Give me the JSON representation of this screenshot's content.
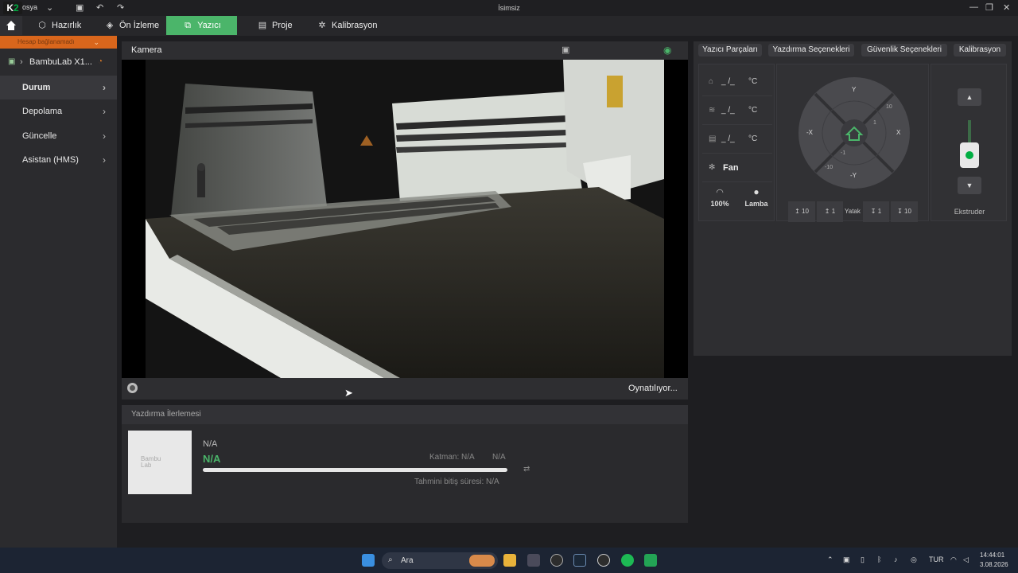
{
  "app": {
    "logo_text": "K2",
    "menu_label": "osya",
    "window_title": "İsimsiz"
  },
  "tabs": [
    {
      "label": "Hazırlık",
      "icon": "cube-icon"
    },
    {
      "label": "Ön İzleme",
      "icon": "layers-icon"
    },
    {
      "label": "Yazıcı",
      "icon": "printer-icon",
      "active": true
    },
    {
      "label": "Proje",
      "icon": "document-icon"
    },
    {
      "label": "Kalibrasyon",
      "icon": "gear-icon"
    }
  ],
  "sidebar": {
    "banner": "Hesap bağlanamadı",
    "printer_name": "BambuLab X1...",
    "items": [
      {
        "label": "Durum",
        "selected": true
      },
      {
        "label": "Depolama"
      },
      {
        "label": "Güncelle"
      },
      {
        "label": "Asistan (HMS)"
      }
    ]
  },
  "camera": {
    "title": "Kamera",
    "status": "Oynatılıyor..."
  },
  "progress": {
    "title": "Yazdırma İlerlemesi",
    "thumbnail_text": "Bambu Lab",
    "task_name": "N/A",
    "status_value": "N/A",
    "layer": "Katman: N/A",
    "percent": "N/A",
    "eta": "Tahmini bitiş süresi: N/A",
    "progress_fraction": 0
  },
  "right_panel": {
    "tabs": [
      "Yazıcı Parçaları",
      "Yazdırma Seçenekleri",
      "Güvenlik Seçenekleri",
      "Kalibrasyon"
    ],
    "temps": [
      {
        "icon": "nozzle-icon",
        "value": "_ /_",
        "unit": "°C"
      },
      {
        "icon": "bed-icon",
        "value": "_ /_",
        "unit": "°C"
      },
      {
        "icon": "chamber-icon",
        "value": "_ /_",
        "unit": "°C"
      }
    ],
    "fan_label": "Fan",
    "speed_label": "100%",
    "lamp_label": "Lamba",
    "jog": {
      "y": "Y",
      "neg_y": "-Y",
      "x": "X",
      "neg_x": "-X",
      "p10": "10",
      "p1": "1",
      "m1": "-1",
      "m10": "-10"
    },
    "bed_buttons": [
      "10",
      "1",
      "1",
      "10"
    ],
    "bed_label": "Yatak",
    "extruder_label": "Ekstruder"
  },
  "taskbar": {
    "search_placeholder": "Ara",
    "language": "TUR",
    "time": "14:44:01",
    "date": "3.08.2026"
  }
}
